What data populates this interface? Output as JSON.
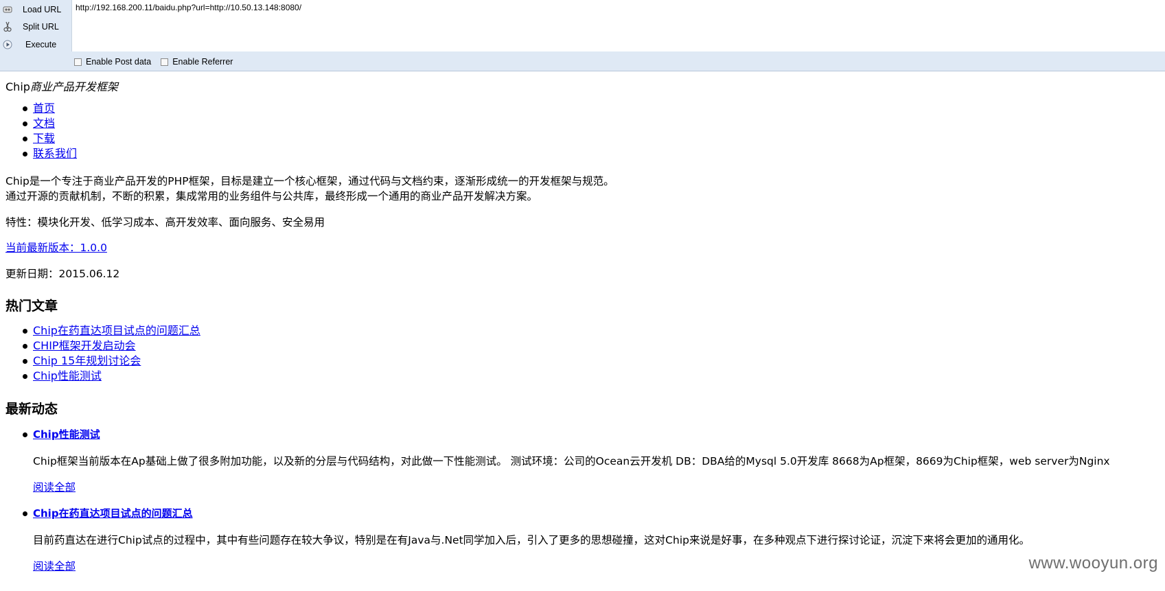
{
  "hackbar": {
    "buttons": [
      {
        "label": "Load URL",
        "icon": "load-url-icon"
      },
      {
        "label": "Split URL",
        "icon": "scissors-icon"
      },
      {
        "label": "Execute",
        "icon": "play-icon"
      }
    ],
    "url_value": "http://192.168.200.11/baidu.php?url=http://10.50.13.148:8080/",
    "checkboxes": [
      {
        "label": "Enable Post data",
        "checked": false
      },
      {
        "label": "Enable Referrer",
        "checked": false
      }
    ]
  },
  "page": {
    "title_brand": "Chip",
    "title_rest": "商业产品开发框架",
    "nav": [
      "首页",
      "文档",
      "下载",
      "联系我们"
    ],
    "intro_line1": "Chip是一个专注于商业产品开发的PHP框架，目标是建立一个核心框架，通过代码与文档约束，逐渐形成统一的开发框架与规范。",
    "intro_line2": "通过开源的贡献机制，不断的积累，集成常用的业务组件与公共库，最终形成一个通用的商业产品开发解决方案。",
    "features": "特性：模块化开发、低学习成本、高开发效率、面向服务、安全易用",
    "version_link": "当前最新版本：1.0.0",
    "update_date": "更新日期：2015.06.12",
    "hot_heading": "热门文章",
    "hot_articles": [
      "Chip在药直达项目试点的问题汇总",
      "CHIP框架开发启动会",
      "Chip 15年规划讨论会",
      "Chip性能测试"
    ],
    "news_heading": "最新动态",
    "news": [
      {
        "title": "Chip性能测试",
        "summary": "Chip框架当前版本在Ap基础上做了很多附加功能，以及新的分层与代码结构，对此做一下性能测试。 测试环境：公司的Ocean云开发机 DB：DBA给的Mysql 5.0开发库 8668为Ap框架，8669为Chip框架，web server为Nginx",
        "more": "阅读全部"
      },
      {
        "title": "Chip在药直达项目试点的问题汇总",
        "summary": "目前药直达在进行Chip试点的过程中，其中有些问题存在较大争议，特别是在有Java与.Net同学加入后，引入了更多的思想碰撞，这对Chip来说是好事，在多种观点下进行探讨论证，沉淀下来将会更加的通用化。",
        "more": "阅读全部"
      }
    ]
  },
  "watermark": "www.wooyun.org"
}
